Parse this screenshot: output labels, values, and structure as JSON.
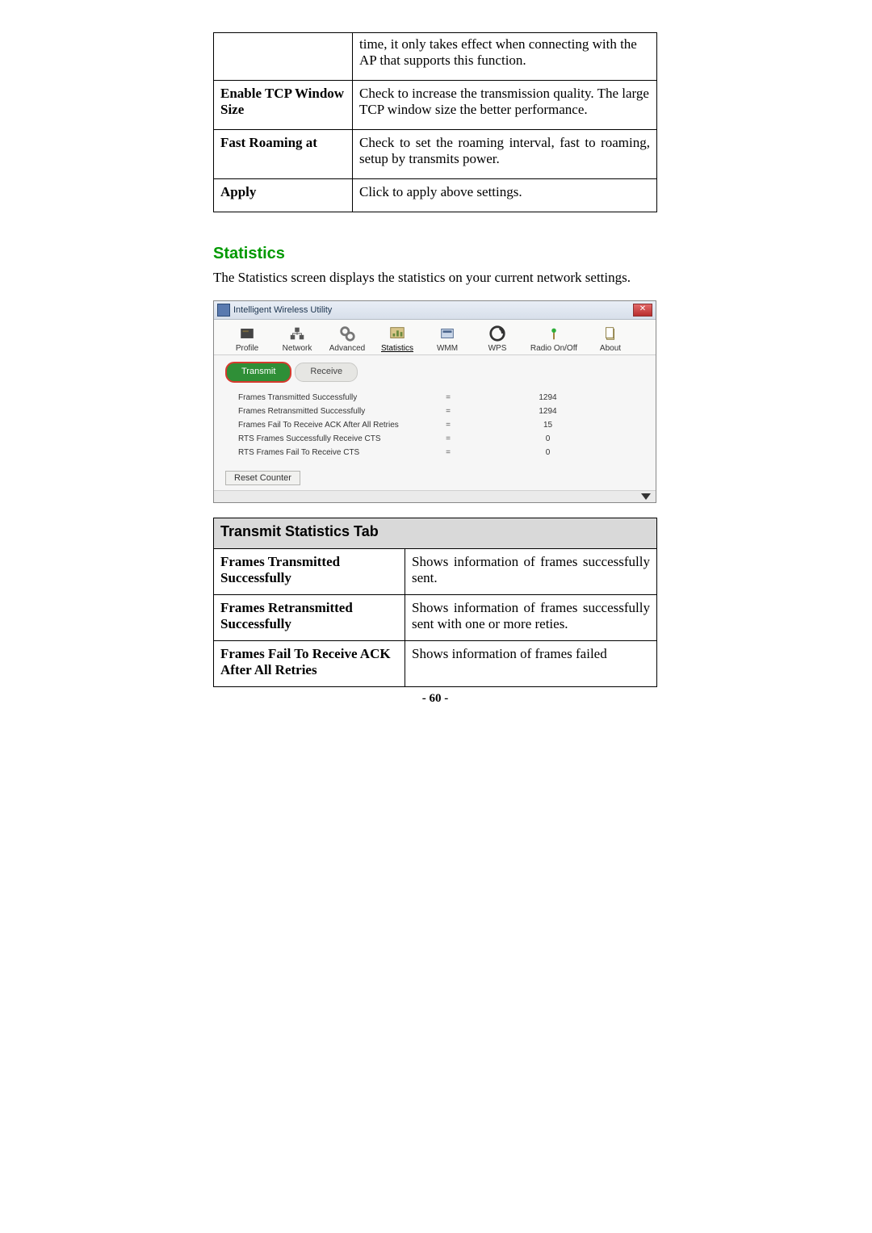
{
  "def_table": {
    "rows": [
      {
        "label": "",
        "desc": "time, it only takes effect when connecting with the AP that supports this function."
      },
      {
        "label": "Enable TCP Window Size",
        "desc": "Check to increase the transmission quality. The large TCP window size the better performance."
      },
      {
        "label": "Fast Roaming at",
        "desc": "Check to set the roaming interval, fast to roaming, setup by transmits power."
      },
      {
        "label": "Apply",
        "desc": "Click to apply above settings."
      }
    ]
  },
  "section": {
    "heading": "Statistics",
    "intro": "The Statistics screen displays the statistics on your current network settings."
  },
  "app_window": {
    "title": "Intelligent Wireless Utility",
    "toolbar": [
      {
        "label": "Profile",
        "name": "profile-icon"
      },
      {
        "label": "Network",
        "name": "network-icon"
      },
      {
        "label": "Advanced",
        "name": "advanced-icon"
      },
      {
        "label": "Statistics",
        "name": "statistics-icon",
        "selected": true
      },
      {
        "label": "WMM",
        "name": "wmm-icon"
      },
      {
        "label": "WPS",
        "name": "wps-icon"
      },
      {
        "label": "Radio On/Off",
        "name": "radio-icon"
      },
      {
        "label": "About",
        "name": "about-icon"
      }
    ],
    "tabs": {
      "active": "Transmit",
      "inactive": "Receive"
    },
    "stats": [
      {
        "label": "Frames Transmitted Successfully",
        "eq": "=",
        "value": "1294"
      },
      {
        "label": "Frames Retransmitted Successfully",
        "eq": "=",
        "value": "1294"
      },
      {
        "label": "Frames Fail To Receive ACK After All Retries",
        "eq": "=",
        "value": "15"
      },
      {
        "label": "RTS Frames Successfully Receive CTS",
        "eq": "=",
        "value": "0"
      },
      {
        "label": "RTS Frames Fail To Receive CTS",
        "eq": "=",
        "value": "0"
      }
    ],
    "reset_label": "Reset Counter"
  },
  "stats_table": {
    "header": "Transmit Statistics Tab",
    "rows": [
      {
        "label": "Frames Transmitted Successfully",
        "desc": "Shows information of frames successfully sent."
      },
      {
        "label": "Frames Retransmitted Successfully",
        "desc": "Shows information of frames successfully sent with one or more reties."
      },
      {
        "label": "Frames Fail To Receive ACK After All Retries",
        "desc": "Shows information of frames failed"
      }
    ]
  },
  "page_number": "- 60 -"
}
